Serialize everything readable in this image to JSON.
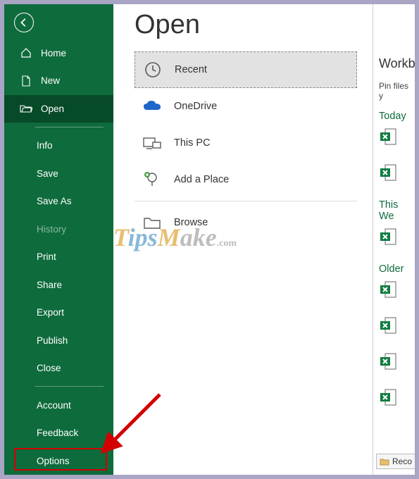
{
  "page": {
    "title": "Open"
  },
  "sidebar": {
    "home": "Home",
    "new": "New",
    "open": "Open",
    "info": "Info",
    "save": "Save",
    "saveas": "Save As",
    "history": "History",
    "print": "Print",
    "share": "Share",
    "export": "Export",
    "publish": "Publish",
    "close": "Close",
    "account": "Account",
    "feedback": "Feedback",
    "options": "Options"
  },
  "locations": {
    "recent": "Recent",
    "onedrive": "OneDrive",
    "thispc": "This PC",
    "addplace": "Add a Place",
    "browse": "Browse"
  },
  "right": {
    "heading": "Workb",
    "sub": "Pin files y",
    "today": "Today",
    "thisweek": "This We",
    "older": "Older",
    "recover": "Reco"
  },
  "watermark": {
    "t": "T",
    "ips": "ips",
    "m": "M",
    "ake": "ake",
    "com": ".com"
  }
}
